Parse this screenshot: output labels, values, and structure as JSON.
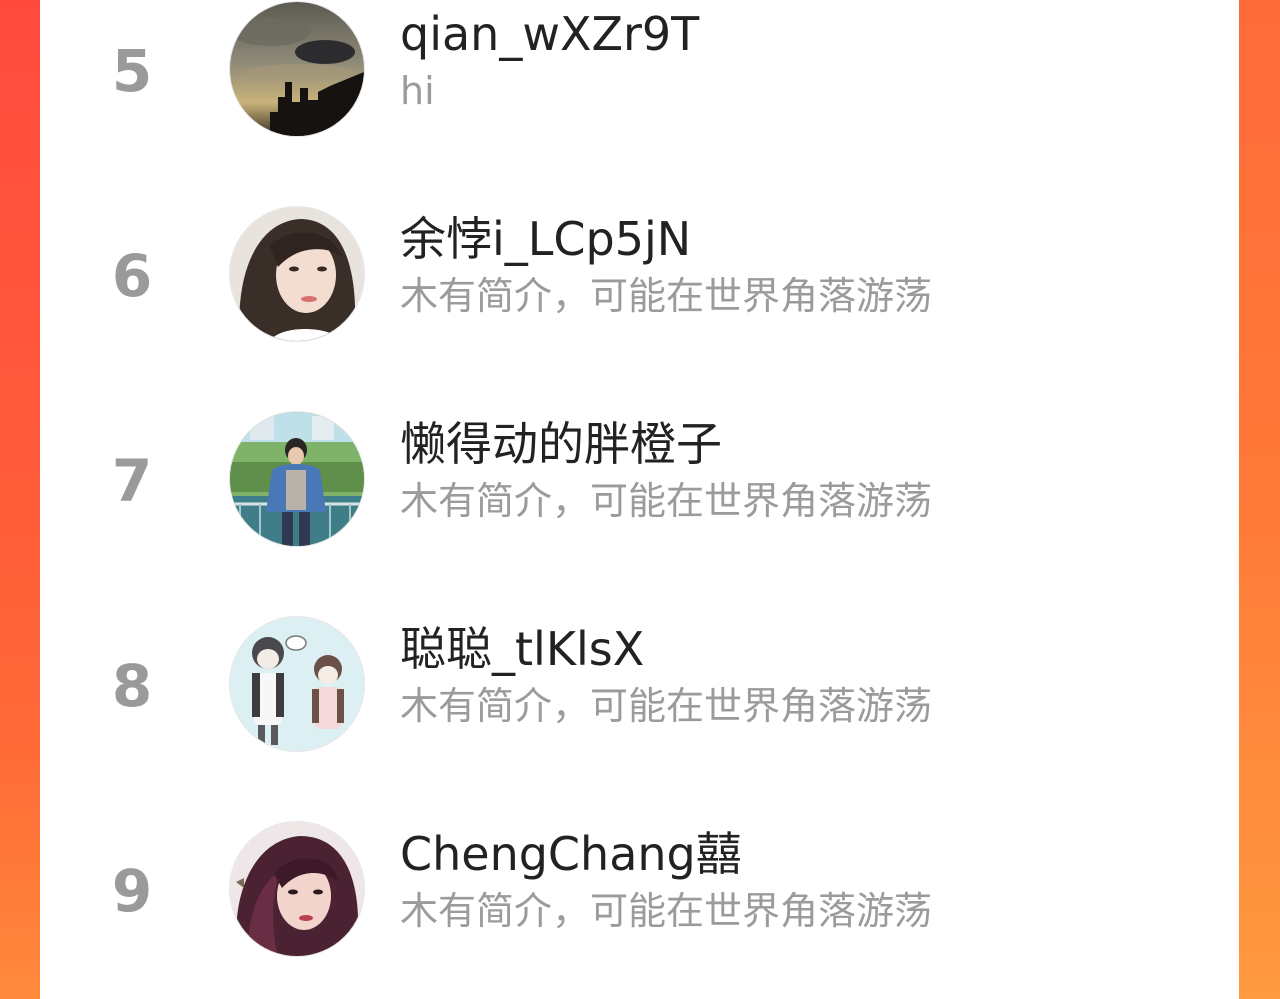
{
  "ranking": {
    "items": [
      {
        "rank": "5",
        "name": "qian_wXZr9T",
        "bio": "hi",
        "avatar": "avatar-skyline-photo"
      },
      {
        "rank": "6",
        "name": "余悖i_LCp5jN",
        "bio": "木有简介，可能在世界角落游荡",
        "avatar": "avatar-girl-portrait"
      },
      {
        "rank": "7",
        "name": "懒得动的胖橙子",
        "bio": "木有简介，可能在世界角落游荡",
        "avatar": "avatar-boy-outdoor"
      },
      {
        "rank": "8",
        "name": "聪聪_tlKlsX",
        "bio": "木有简介，可能在世界角落游荡",
        "avatar": "avatar-cartoon-couple"
      },
      {
        "rank": "9",
        "name": "ChengChang囍",
        "bio": "木有简介，可能在世界角落游荡",
        "avatar": "avatar-woman-portrait"
      }
    ]
  },
  "colors": {
    "background_gradient_start": "#ff4b3e",
    "background_gradient_end": "#ff8a3c",
    "card": "#ffffff",
    "rank_text": "#9a9a9a",
    "name_text": "#222222",
    "bio_text": "#9b9b9b"
  }
}
